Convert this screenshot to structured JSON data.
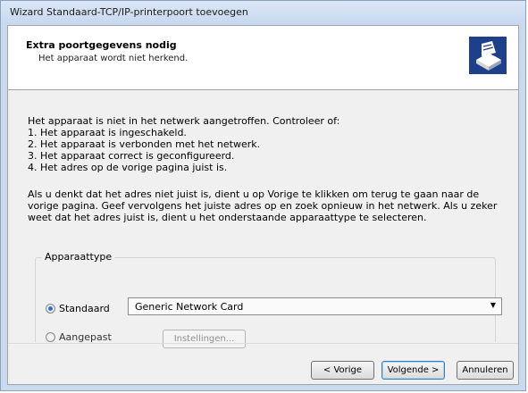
{
  "window": {
    "title": "Wizard Standaard-TCP/IP-printerpoort toevoegen"
  },
  "header": {
    "title": "Extra poortgegevens nodig",
    "subtitle": "Het apparaat wordt niet herkend.",
    "icon": "printer-port-icon"
  },
  "intro": {
    "lead": "Het apparaat is niet in het netwerk aangetroffen. Controleer of:",
    "items": [
      "1. Het apparaat is ingeschakeld.",
      "2. Het apparaat is verbonden met het netwerk.",
      "3. Het apparaat correct is geconfigureerd.",
      "4. Het adres op de vorige pagina juist is."
    ]
  },
  "advice": "Als u denkt dat het adres niet juist is, dient u op Vorige te klikken om terug te gaan naar de vorige pagina. Geef vervolgens het juiste adres op en zoek opnieuw in het netwerk. Als u zeker weet dat het adres juist is, dient u het onderstaande apparaattype te selecteren.",
  "device_type": {
    "legend": "Apparaattype",
    "standard_label": "Standaard",
    "standard_value": "Generic Network Card",
    "custom_label": "Aangepast",
    "settings_label": "Instellingen..."
  },
  "buttons": {
    "back": "< Vorige",
    "next": "Volgende >",
    "cancel": "Annuleren"
  }
}
